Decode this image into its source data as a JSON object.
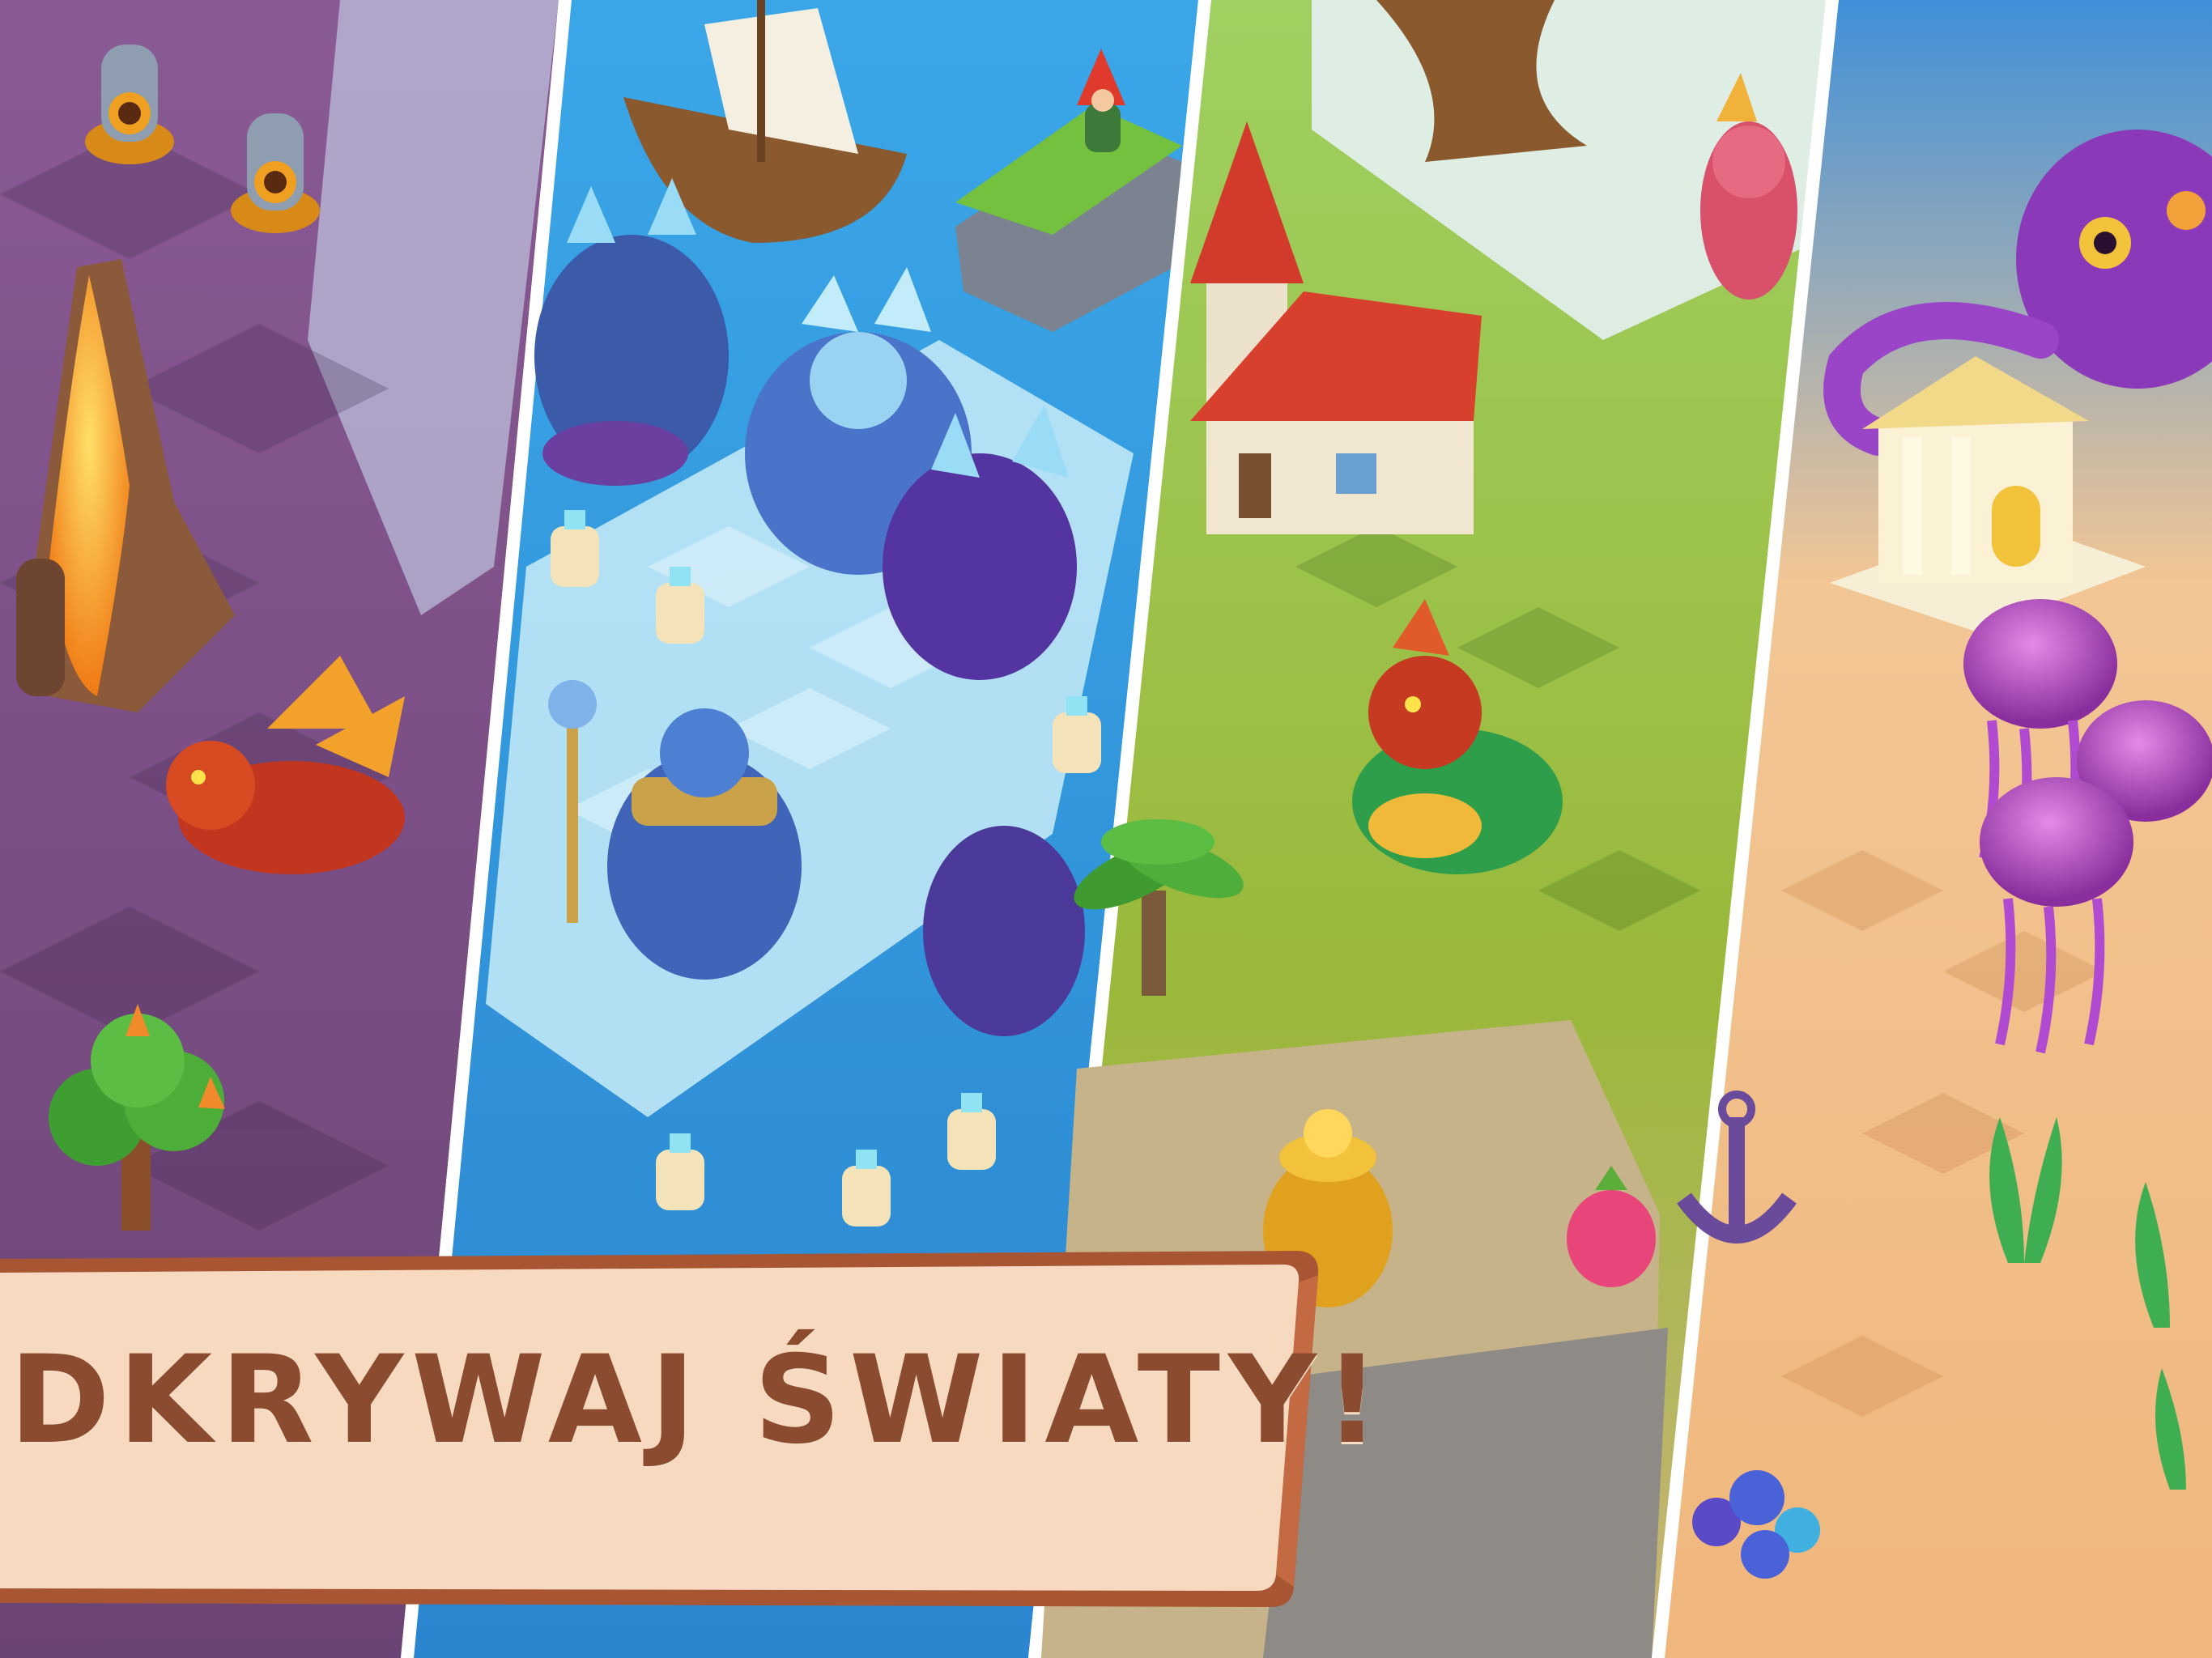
{
  "banner": {
    "title": "ODKRYWAJ ŚWIATY!"
  },
  "worlds": [
    {
      "theme": "volcano"
    },
    {
      "theme": "ice"
    },
    {
      "theme": "meadow"
    },
    {
      "theme": "undersea"
    }
  ],
  "colors": {
    "volcano_ground": "#7a4f86",
    "ice_water": "#2f9be0",
    "meadow_grass": "#8cc04a",
    "sand": "#f3c48f",
    "banner_fill": "#f7d9c0",
    "banner_border": "#b35f3a",
    "banner_text": "#8a4b2e"
  }
}
